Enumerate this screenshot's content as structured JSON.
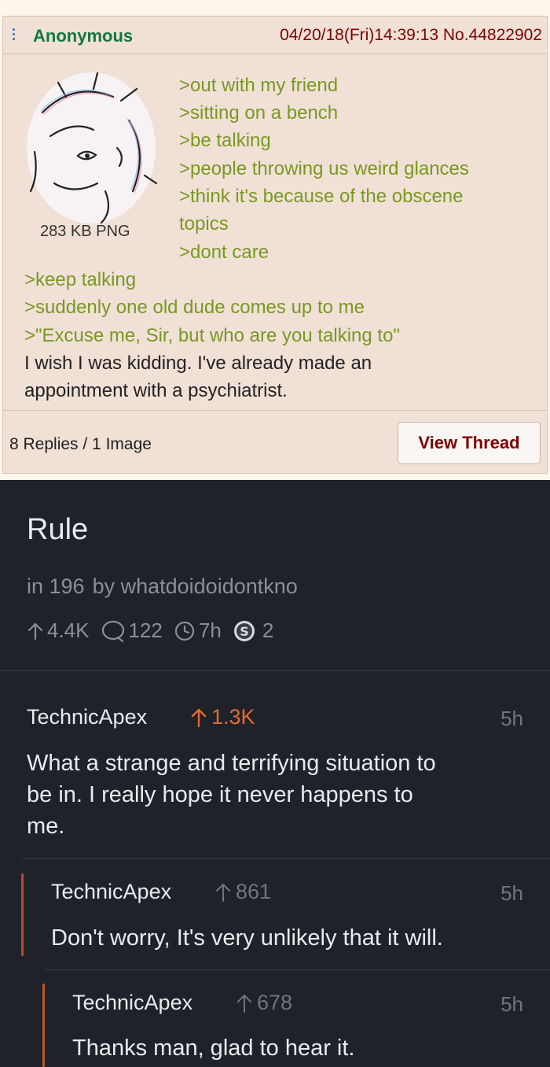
{
  "chan_post": {
    "name": "Anonymous",
    "meta": "04/20/18(Fri)14:39:13 No.44822902",
    "file_info": "283 KB PNG",
    "greentext": [
      ">out with my friend",
      ">sitting on a bench",
      ">be talking",
      ">people throwing us weird glances",
      ">think it's because of the obscene",
      "topics",
      ">dont care",
      ">keep talking",
      ">suddenly one old dude comes up to me",
      ">\"Excuse me, Sir, but who are you talking to\""
    ],
    "closing": [
      "I wish I was kidding. I've already made an",
      "appointment with a psychiatrist."
    ],
    "replies": "8 Replies / 1 Image",
    "view_thread": "View Thread"
  },
  "reddit_post": {
    "title": "Rule",
    "sub_in": "in 196",
    "sub_by": "by whatdoidoidontkno",
    "upvotes": "4.4K",
    "comments": "122",
    "age": "7h",
    "awards": "2",
    "colors": {
      "op_score": "#e5682e",
      "score_muted": "#6f757b",
      "bar1": "#c1452c",
      "bar2": "#b65a23"
    }
  },
  "comments": [
    {
      "user": "TechnicApex",
      "score": "1.3K",
      "time": "5h",
      "lines": [
        "What a strange and terrifying situation to",
        "be in. I really hope it never happens to",
        "me."
      ]
    },
    {
      "user": "TechnicApex",
      "score": "861",
      "time": "5h",
      "lines": [
        "Don't worry, It's very unlikely that it will."
      ]
    },
    {
      "user": "TechnicApex",
      "score": "678",
      "time": "5h",
      "lines": [
        "Thanks man, glad to hear it."
      ]
    }
  ]
}
